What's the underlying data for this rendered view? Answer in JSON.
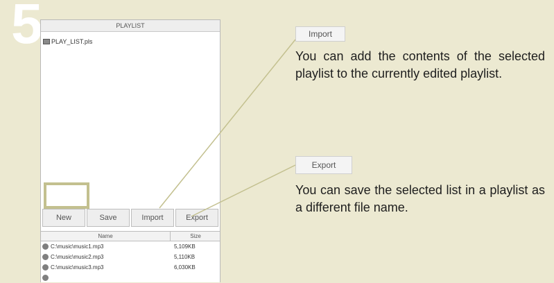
{
  "step": "5",
  "panel": {
    "title": "PLAYLIST",
    "file": "PLAY_LIST.pls",
    "buttons": {
      "new": "New",
      "save": "Save",
      "import": "Import",
      "export": "Export"
    },
    "table": {
      "headers": {
        "name": "Name",
        "size": "Size"
      },
      "rows": [
        {
          "name": "C:\\music\\music1.mp3",
          "size": "5,109KB"
        },
        {
          "name": "C:\\music\\music2.mp3",
          "size": "5,110KB"
        },
        {
          "name": "C:\\music\\music3.mp3",
          "size": "6,030KB"
        }
      ]
    }
  },
  "callouts": {
    "import": {
      "label": "Import",
      "text": "You can add the contents of the selected playlist to the currently edited playlist."
    },
    "export": {
      "label": "Export",
      "text": "You can save the selected list in a playlist as a different file name."
    }
  },
  "colors": {
    "background": "#ece9d1",
    "line": "#c3c08f",
    "highlight": "#c3c08f"
  }
}
